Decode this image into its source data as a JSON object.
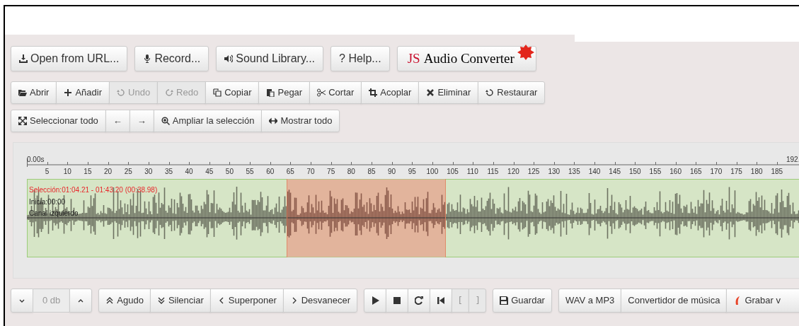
{
  "top_buttons": [
    {
      "label": "Open from URL..."
    },
    {
      "label": "Record..."
    },
    {
      "label": "Sound Library..."
    },
    {
      "label": "? Help..."
    }
  ],
  "logo": {
    "prefix": "JS",
    "name": "Audio Converter"
  },
  "edit_toolbar": [
    {
      "label": "Abrir",
      "disabled": false
    },
    {
      "label": "Añadir",
      "disabled": false
    },
    {
      "label": "Undo",
      "disabled": true
    },
    {
      "label": "Redo",
      "disabled": true
    },
    {
      "label": "Copiar",
      "disabled": false
    },
    {
      "label": "Pegar",
      "disabled": false
    },
    {
      "label": "Cortar",
      "disabled": false
    },
    {
      "label": "Acoplar",
      "disabled": false
    },
    {
      "label": "Eliminar",
      "disabled": false
    },
    {
      "label": "Restaurar",
      "disabled": false
    }
  ],
  "view_toolbar": [
    {
      "label": "Seleccionar todo"
    },
    {
      "label": "←"
    },
    {
      "label": "→"
    },
    {
      "label": "Ampliar la selección"
    },
    {
      "label": "Mostrar todo"
    }
  ],
  "ruler": {
    "start_label": "0.00s",
    "end_label": "192.",
    "ticks": [
      "5",
      "10",
      "15",
      "20",
      "25",
      "30",
      "35",
      "40",
      "45",
      "50",
      "55",
      "60",
      "65",
      "70",
      "75",
      "80",
      "85",
      "90",
      "95",
      "100",
      "105",
      "110",
      "115",
      "120",
      "125",
      "130",
      "135",
      "140",
      "145",
      "150",
      "155",
      "160",
      "165",
      "170",
      "175",
      "180",
      "185"
    ]
  },
  "waveform": {
    "selection_label": "Selección:01:04.21 - 01:43.20 (00:38.98)",
    "start_label": "Inicia:00:00",
    "channel_label": "Canal izquierdo",
    "selection_start": {
      "level": 0.3345
    },
    "selection_end": {
      "level": 0.5375
    }
  },
  "volume": {
    "value": "0 db"
  },
  "effects": [
    {
      "label": "Agudo"
    },
    {
      "label": "Silenciar"
    },
    {
      "label": "Superponer"
    },
    {
      "label": "Desvanecer"
    }
  ],
  "playback": [
    {
      "disabled": false
    },
    {
      "disabled": false
    },
    {
      "disabled": false
    },
    {
      "disabled": false
    },
    {
      "label": "[",
      "disabled": true
    },
    {
      "label": "]",
      "disabled": true
    }
  ],
  "save_button": {
    "label": "Guardar"
  },
  "links": [
    {
      "label": "WAV a MP3"
    },
    {
      "label": "Convertidor de música"
    },
    {
      "label": "Grabar v"
    }
  ]
}
